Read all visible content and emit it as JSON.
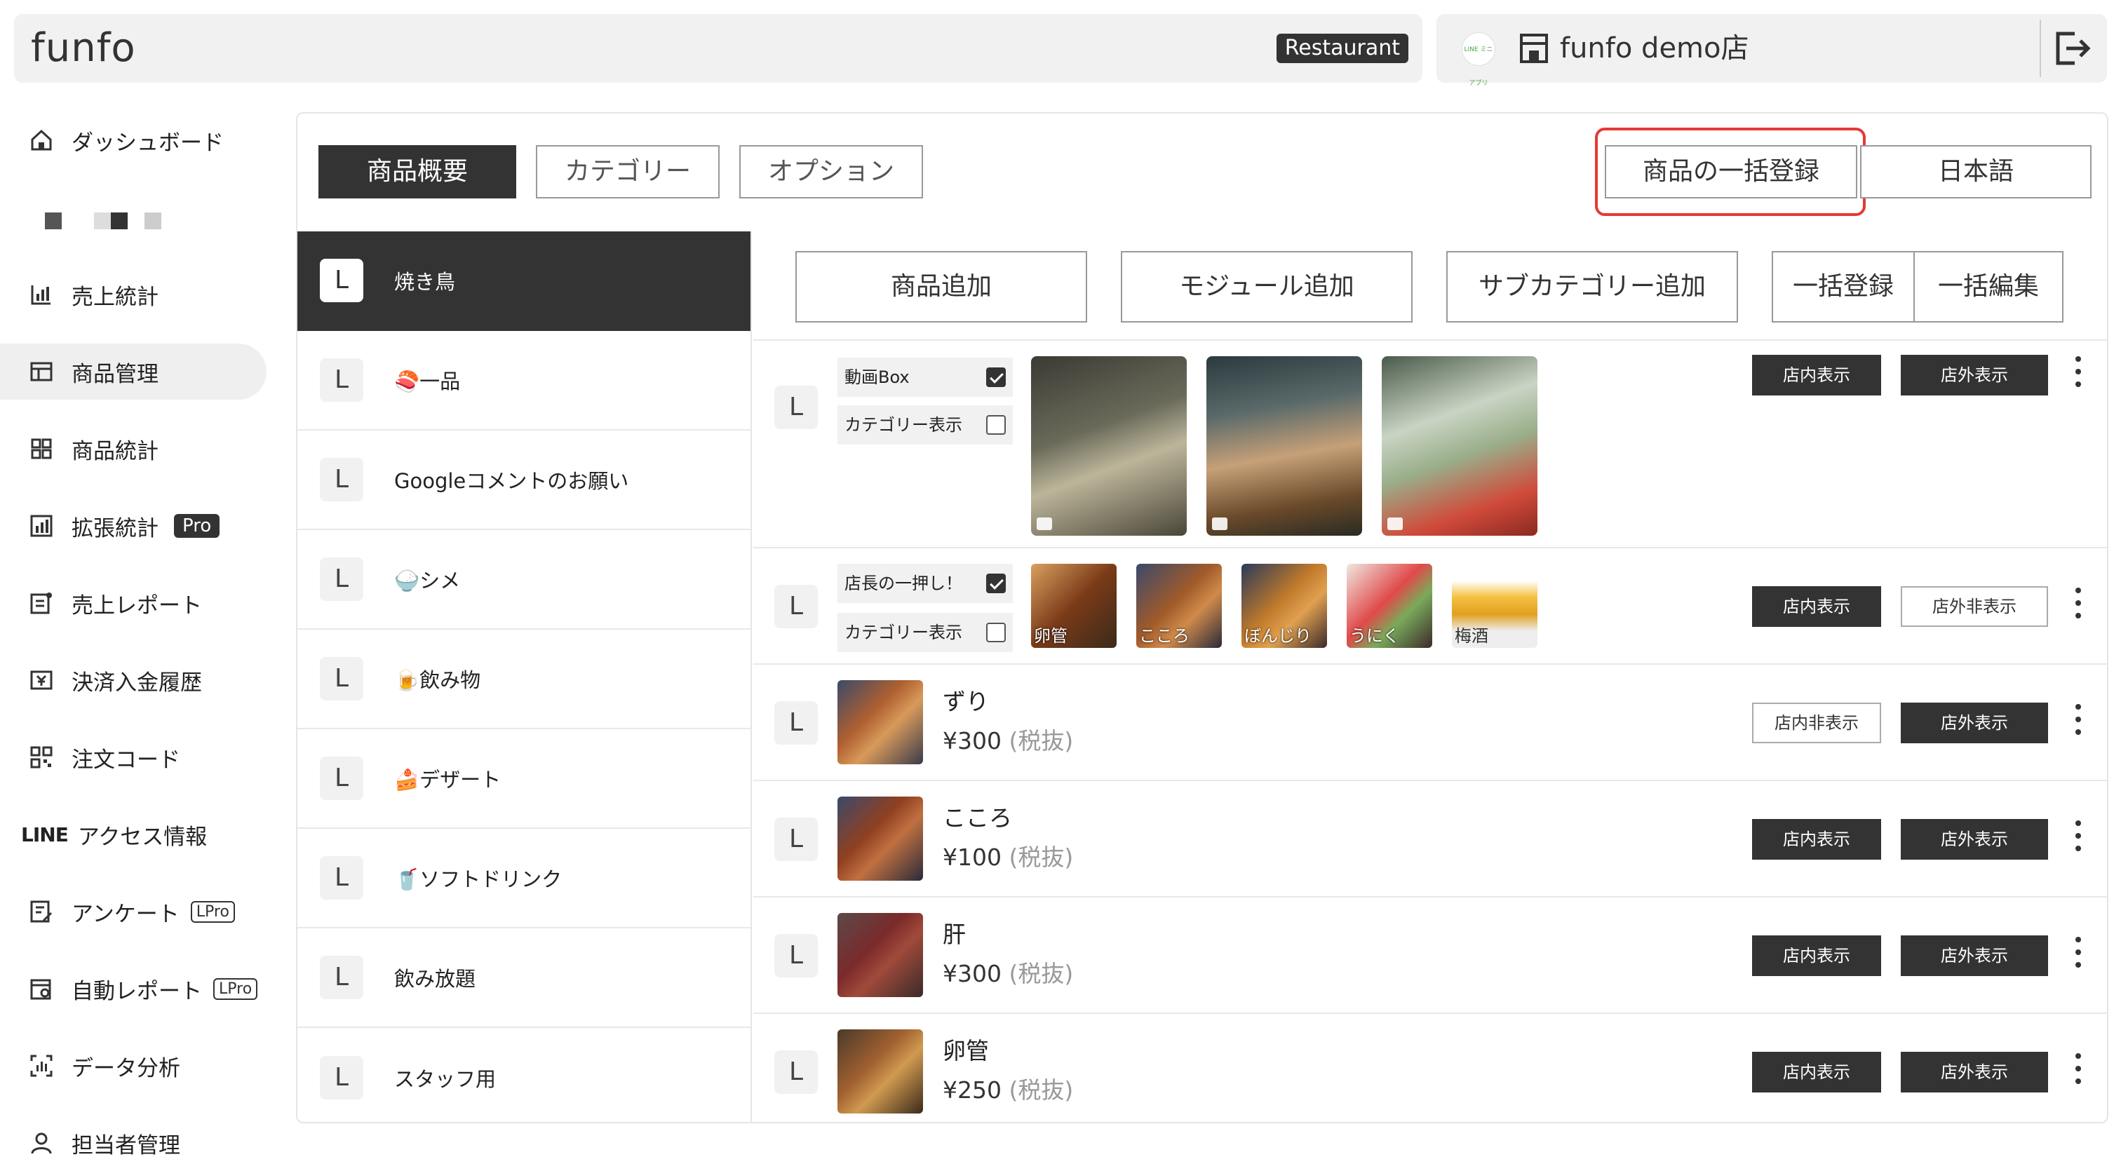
{
  "header": {
    "logo": "funfo",
    "badge": "Restaurant",
    "line_avatar_text": "LINE ミニアプリ",
    "store_name": "funfo demo店"
  },
  "sidebar": {
    "items": [
      {
        "label": "ダッシュボード"
      },
      {
        "label": "売上統計"
      },
      {
        "label": "商品管理",
        "active": true
      },
      {
        "label": "商品統計"
      },
      {
        "label": "拡張統計",
        "badge": "Pro"
      },
      {
        "label": "売上レポート"
      },
      {
        "label": "決済入金履歴"
      },
      {
        "label": "注文コード"
      },
      {
        "label": "アクセス情報",
        "prefix": "LINE"
      },
      {
        "label": "アンケート",
        "badge": "LPro"
      },
      {
        "label": "自動レポート",
        "badge": "LPro"
      },
      {
        "label": "データ分析"
      },
      {
        "label": "担当者管理"
      }
    ]
  },
  "tabs": {
    "overview": "商品概要",
    "category": "カテゴリー",
    "option": "オプション",
    "bulk_register": "商品の一括登録",
    "language": "日本語"
  },
  "categories": [
    {
      "label": "焼き鳥",
      "active": true
    },
    {
      "label": "🍣一品"
    },
    {
      "label": "Googleコメントのお願い"
    },
    {
      "label": "🍚シメ"
    },
    {
      "label": "🍺飲み物"
    },
    {
      "label": "🍰デザート"
    },
    {
      "label": "🥤ソフトドリンク"
    },
    {
      "label": "飲み放題"
    },
    {
      "label": "スタッフ用"
    }
  ],
  "actions": {
    "add_product": "商品追加",
    "add_module": "モジュール追加",
    "add_subcategory": "サブカテゴリー追加",
    "bulk_register": "一括登録",
    "bulk_edit": "一括編集"
  },
  "L": "L",
  "module_video": {
    "box_label": "動画Box",
    "box_checked": true,
    "category_label": "カテゴリー表示",
    "category_checked": false,
    "store_in": "店内表示",
    "store_out": "店外表示"
  },
  "module_recommend": {
    "box_label": "店長の一押し！",
    "box_checked": true,
    "category_label": "カテゴリー表示",
    "category_checked": false,
    "thumbs": [
      "卵管",
      "こころ",
      "ぼんじり",
      "うにく",
      "梅酒"
    ],
    "store_in": "店内表示",
    "store_out": "店外非表示"
  },
  "products": [
    {
      "name": "ずり",
      "price": "¥300",
      "tax": "(税抜)",
      "store_in": "店内非表示",
      "store_out": "店外表示"
    },
    {
      "name": "こころ",
      "price": "¥100",
      "tax": "(税抜)",
      "store_in": "店内表示",
      "store_out": "店外表示"
    },
    {
      "name": "肝",
      "price": "¥300",
      "tax": "(税抜)",
      "store_in": "店内表示",
      "store_out": "店外表示"
    },
    {
      "name": "卵管",
      "price": "¥250",
      "tax": "(税抜)",
      "store_in": "店内表示",
      "store_out": "店外表示"
    }
  ]
}
